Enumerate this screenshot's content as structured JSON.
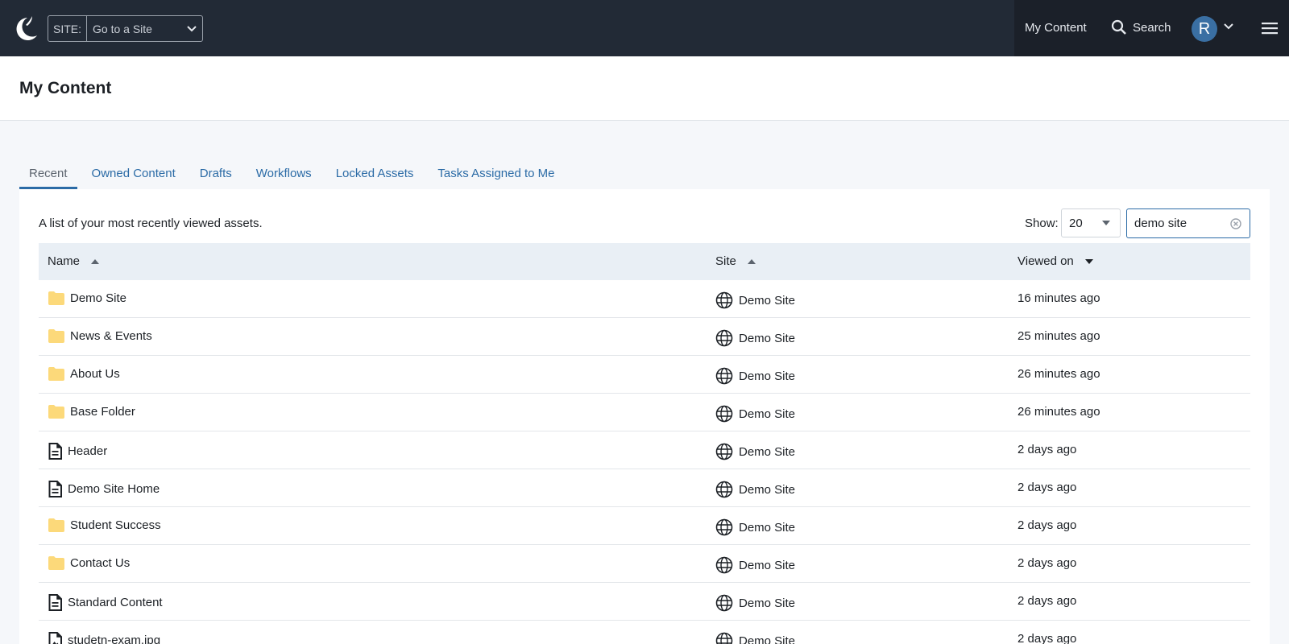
{
  "topbar": {
    "site_prefix": "SITE:",
    "site_placeholder": "Go to a Site",
    "nav_my_content": "My Content",
    "nav_search": "Search",
    "avatar_initial": "R"
  },
  "header": {
    "title": "My Content"
  },
  "tabs": [
    {
      "label": "Recent",
      "active": true
    },
    {
      "label": "Owned Content",
      "active": false
    },
    {
      "label": "Drafts",
      "active": false
    },
    {
      "label": "Workflows",
      "active": false
    },
    {
      "label": "Locked Assets",
      "active": false
    },
    {
      "label": "Tasks Assigned to Me",
      "active": false
    }
  ],
  "panel": {
    "description": "A list of your most recently viewed assets.",
    "show_label": "Show:",
    "show_value": "20",
    "filter_value": "demo site"
  },
  "table": {
    "columns": {
      "name": "Name",
      "site": "Site",
      "viewed": "Viewed on"
    },
    "rows": [
      {
        "name": "Demo Site",
        "type": "folder",
        "site": "Demo Site",
        "viewed": "16 minutes ago"
      },
      {
        "name": "News & Events",
        "type": "folder",
        "site": "Demo Site",
        "viewed": "25 minutes ago"
      },
      {
        "name": "About Us",
        "type": "folder",
        "site": "Demo Site",
        "viewed": "26 minutes ago"
      },
      {
        "name": "Base Folder",
        "type": "folder",
        "site": "Demo Site",
        "viewed": "26 minutes ago"
      },
      {
        "name": "Header",
        "type": "page",
        "site": "Demo Site",
        "viewed": "2 days ago"
      },
      {
        "name": "Demo Site Home",
        "type": "page",
        "site": "Demo Site",
        "viewed": "2 days ago"
      },
      {
        "name": "Student Success",
        "type": "folder",
        "site": "Demo Site",
        "viewed": "2 days ago"
      },
      {
        "name": "Contact Us",
        "type": "folder",
        "site": "Demo Site",
        "viewed": "2 days ago"
      },
      {
        "name": "Standard Content",
        "type": "page",
        "site": "Demo Site",
        "viewed": "2 days ago"
      },
      {
        "name": "studetn-exam.jpg",
        "type": "image",
        "site": "Demo Site",
        "viewed": "2 days ago"
      }
    ]
  },
  "colors": {
    "topbar_bg": "#222a36",
    "accent": "#2b6ba6",
    "folder": "#fcd97a"
  }
}
